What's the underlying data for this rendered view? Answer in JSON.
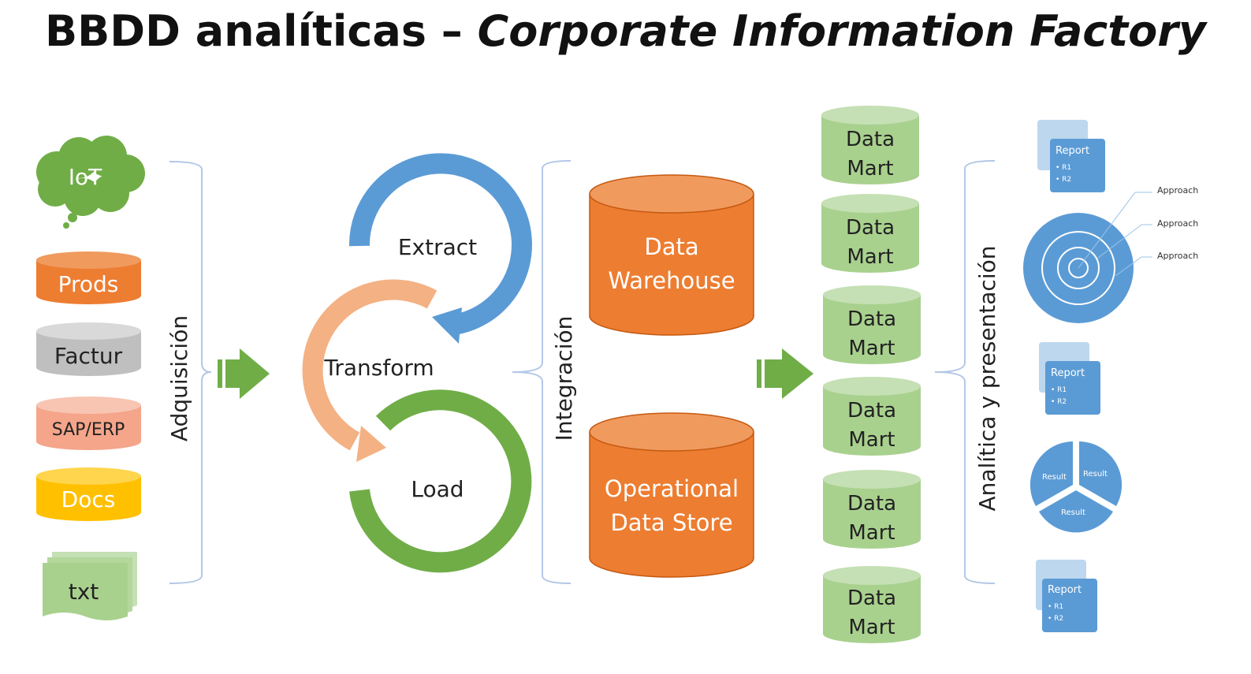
{
  "title": {
    "main": "BBDD analíticas – ",
    "italic": "Corporate Information Factory"
  },
  "sources": [
    {
      "label": "IoT",
      "shape": "cloud",
      "color": "#70ad47",
      "text_color": "#ffffff"
    },
    {
      "label": "Prods",
      "shape": "cylinder",
      "color": "#ed7d31",
      "text_color": "#ffffff"
    },
    {
      "label": "Factur",
      "shape": "cylinder",
      "color": "#bfbfbf",
      "text_color": "#222222"
    },
    {
      "label": "SAP/ERP",
      "shape": "cylinder",
      "color": "#f4a58a",
      "text_color": "#222222"
    },
    {
      "label": "Docs",
      "shape": "cylinder",
      "color": "#ffc000",
      "text_color": "#ffffff"
    },
    {
      "label": "txt",
      "shape": "documents",
      "color": "#a9d18e",
      "text_color": "#222222"
    }
  ],
  "stages": {
    "acquisition": "Adquisición",
    "integration": "Integración",
    "analytics": "Analítica y presentación"
  },
  "etl": {
    "extract": "Extract",
    "transform": "Transform",
    "load": "Load"
  },
  "storage": {
    "warehouse": [
      "Data",
      "Warehouse"
    ],
    "ods": [
      "Operational",
      "Data Store"
    ]
  },
  "data_marts": [
    [
      "Data",
      "Mart"
    ],
    [
      "Data",
      "Mart"
    ],
    [
      "Data",
      "Mart"
    ],
    [
      "Data",
      "Mart"
    ],
    [
      "Data",
      "Mart"
    ],
    [
      "Data",
      "Mart"
    ]
  ],
  "outputs": {
    "report": {
      "title": "Report",
      "items": [
        "• R1",
        "• R2"
      ]
    },
    "approach_labels": [
      "Approach",
      "Approach",
      "Approach"
    ],
    "result_labels": [
      "Result",
      "Result",
      "Result"
    ]
  },
  "colors": {
    "orange": "#ed7d31",
    "green": "#70ad47",
    "light_green": "#a9d18e",
    "blue": "#5b9bd5",
    "salmon": "#f4b183",
    "bracket": "#b4c7e7"
  }
}
